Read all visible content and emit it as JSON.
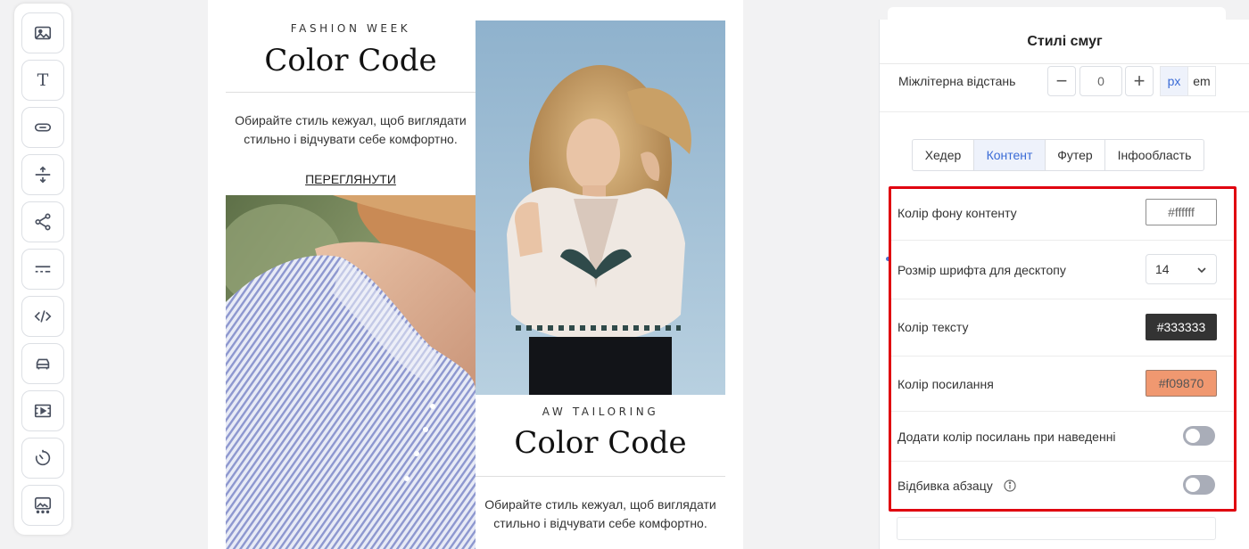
{
  "toolbar": {
    "tools": [
      {
        "name": "image-block-icon"
      },
      {
        "name": "text-block-icon",
        "glyph": "T"
      },
      {
        "name": "button-block-icon"
      },
      {
        "name": "spacer-block-icon"
      },
      {
        "name": "social-block-icon"
      },
      {
        "name": "divider-block-icon"
      },
      {
        "name": "html-block-icon"
      },
      {
        "name": "menu-block-icon"
      },
      {
        "name": "video-block-icon"
      },
      {
        "name": "timer-block-icon"
      },
      {
        "name": "banner-block-icon"
      }
    ]
  },
  "email": {
    "left": {
      "kicker": "FASHION WEEK",
      "headline": "Color Code",
      "body_line1": "Обирайте стиль кежуал, щоб виглядати",
      "body_line2": "стильно і відчувати себе комфортно.",
      "cta": "ПЕРЕГЛЯНУТИ"
    },
    "right": {
      "kicker": "AW TAILORING",
      "headline": "Color Code",
      "body_line1": "Обирайте стиль кежуал, щоб виглядати",
      "body_line2": "стильно і відчувати себе комфортно."
    }
  },
  "panel": {
    "title": "Стилі смуг",
    "letter_spacing": {
      "label": "Міжлітерна відстань",
      "value": "0",
      "minus": "−",
      "plus": "+",
      "units": [
        "px",
        "em"
      ],
      "active_unit": "px"
    },
    "tabs": [
      "Хедер",
      "Контент",
      "Футер",
      "Інфообласть"
    ],
    "active_tab": "Контент",
    "settings": {
      "bg_color": {
        "label": "Колір фону контенту",
        "value": "#ffffff"
      },
      "font_size": {
        "label": "Розмір шрифта для десктопу",
        "value": "14"
      },
      "text_color": {
        "label": "Колір тексту",
        "value": "#333333"
      },
      "link_color": {
        "label": "Колір посилання",
        "value": "#f09870"
      },
      "hover_link": {
        "label": "Додати колір посилань при наведенні",
        "enabled": false
      },
      "paragraph_spacing": {
        "label": "Відбивка абзацу",
        "enabled": false
      }
    }
  },
  "colors": {
    "accent_blue": "#3a6bd6",
    "highlight_red": "#e0000f",
    "text_color_swatch": "#333333",
    "link_color_swatch": "#f09870",
    "toggle_off": "#a9adb8"
  }
}
